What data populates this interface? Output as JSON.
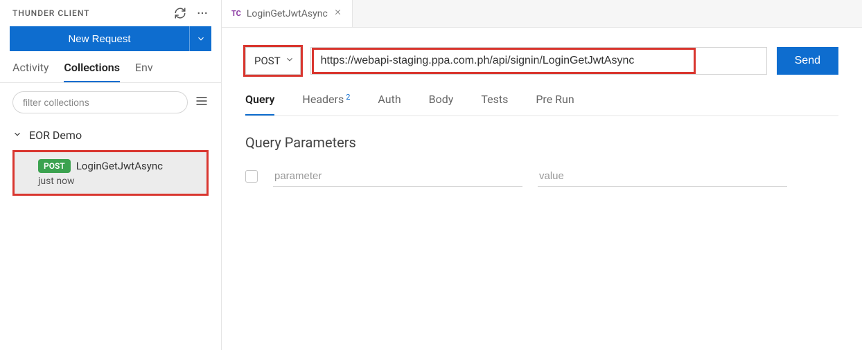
{
  "sidebar": {
    "title": "THUNDER CLIENT",
    "newRequestLabel": "New Request",
    "tabs": [
      "Activity",
      "Collections",
      "Env"
    ],
    "activeTab": 1,
    "filterPlaceholder": "filter collections",
    "collection": {
      "name": "EOR Demo",
      "request": {
        "method": "POST",
        "name": "LoginGetJwtAsync",
        "time": "just now"
      }
    }
  },
  "editor": {
    "tab": {
      "badge": "TC",
      "label": "LoginGetJwtAsync"
    },
    "method": "POST",
    "url": "https://webapi-staging.ppa.com.ph/api/signin/LoginGetJwtAsync",
    "sendLabel": "Send",
    "reqTabs": [
      {
        "label": "Query",
        "count": null
      },
      {
        "label": "Headers",
        "count": "2"
      },
      {
        "label": "Auth",
        "count": null
      },
      {
        "label": "Body",
        "count": null
      },
      {
        "label": "Tests",
        "count": null
      },
      {
        "label": "Pre Run",
        "count": null
      }
    ],
    "activeReqTab": 0,
    "sectionTitle": "Query Parameters",
    "paramPlaceholder": "parameter",
    "valuePlaceholder": "value"
  }
}
